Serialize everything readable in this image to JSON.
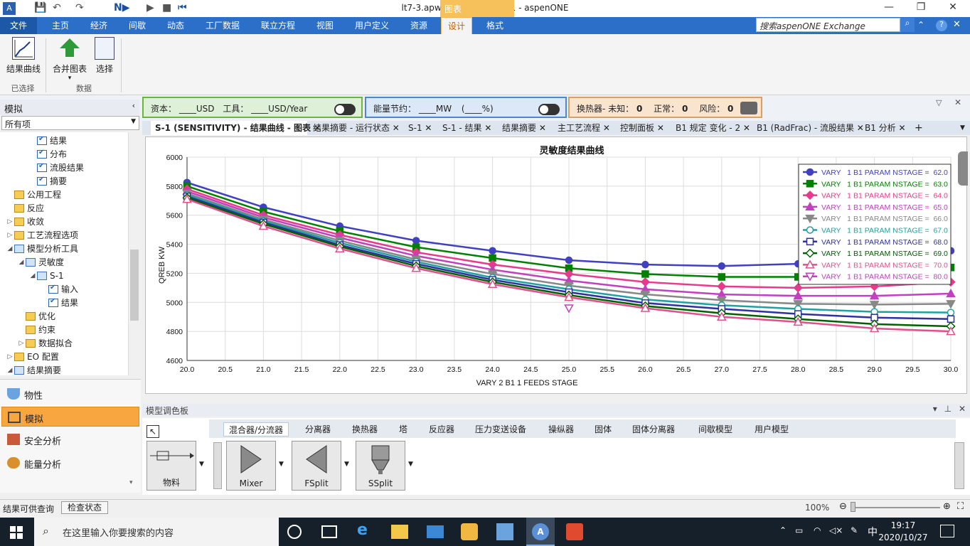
{
  "window": {
    "title": "lt7-3.apw - Aspen Plus V11 - aspenONE",
    "context_tab": "图表"
  },
  "ribbon_tabs": [
    "文件",
    "主页",
    "经济",
    "间歇",
    "动态",
    "工厂数据",
    "联立方程",
    "视图",
    "用户定义",
    "资源",
    "设计",
    "格式"
  ],
  "search": {
    "placeholder": "搜索aspenONE Exchange"
  },
  "ribbon": {
    "result_curve": "结果曲线",
    "merge_chart": "合并图表",
    "select": "选择",
    "group_selected": "已选择",
    "group_data": "数据"
  },
  "info": {
    "capital_label": "资本：",
    "capital_value": "____USD",
    "utility_label": "工具：",
    "utility_value": "____USD/Year",
    "energy_label": "能量节约：",
    "energy_value": "____MW",
    "energy_pct": "(____%)",
    "hx_label": "换热器- 未知：",
    "hx_unknown": "0",
    "hx_normal_label": "正常：",
    "hx_normal": "0",
    "hx_risk_label": "风险：",
    "hx_risk": "0"
  },
  "nav": {
    "title": "模拟",
    "filter": "所有项",
    "tree": [
      {
        "label": "结果",
        "level": 3,
        "icon": "check"
      },
      {
        "label": "分布",
        "level": 3,
        "icon": "check"
      },
      {
        "label": "流股结果",
        "level": 3,
        "icon": "check"
      },
      {
        "label": "摘要",
        "level": 3,
        "icon": "check"
      },
      {
        "label": "公用工程",
        "level": 1,
        "icon": "folder"
      },
      {
        "label": "反应",
        "level": 1,
        "icon": "folder"
      },
      {
        "label": "收敛",
        "level": 1,
        "icon": "folder",
        "tw": "▷"
      },
      {
        "label": "工艺流程选项",
        "level": 1,
        "icon": "folder",
        "tw": "▷"
      },
      {
        "label": "模型分析工具",
        "level": 1,
        "icon": "blue",
        "tw": "◢"
      },
      {
        "label": "灵敏度",
        "level": 2,
        "icon": "blue",
        "tw": "◢"
      },
      {
        "label": "S-1",
        "level": 3,
        "icon": "blue",
        "tw": "◢"
      },
      {
        "label": "输入",
        "level": 4,
        "icon": "check"
      },
      {
        "label": "结果",
        "level": 4,
        "icon": "check"
      },
      {
        "label": "优化",
        "level": 2,
        "icon": "folder"
      },
      {
        "label": "约束",
        "level": 2,
        "icon": "folder"
      },
      {
        "label": "数据拟合",
        "level": 2,
        "icon": "folder",
        "tw": "▷"
      },
      {
        "label": "EO 配置",
        "level": 1,
        "icon": "folder",
        "tw": "▷"
      },
      {
        "label": "结果摘要",
        "level": 1,
        "icon": "blue",
        "tw": "◢"
      }
    ],
    "buttons": [
      "物性",
      "模拟",
      "安全分析",
      "能量分析"
    ]
  },
  "doc_tabs": [
    "S-1 (SENSITIVITY) - 结果曲线 - 图表",
    "结果摘要 - 运行状态",
    "S-1",
    "S-1 - 结果",
    "结果摘要",
    "主工艺流程",
    "控制面板",
    "B1 规定 变化 - 2",
    "B1 (RadFrac) - 流股结果",
    "B1 分析"
  ],
  "palette": {
    "title": "模型调色板",
    "tabs": [
      "混合器/分流器",
      "分离器",
      "换热器",
      "塔",
      "反应器",
      "压力变送设备",
      "操纵器",
      "固体",
      "固体分离器",
      "间歇模型",
      "用户模型"
    ],
    "items": [
      "物料",
      "Mixer",
      "FSplit",
      "SSplit"
    ]
  },
  "status": {
    "left": "结果可供查询",
    "check_btn": "检查状态",
    "zoom": "100%"
  },
  "taskbar": {
    "search": "在这里输入你要搜索的内容",
    "time": "19:17",
    "date": "2020/10/27",
    "ime": "中"
  },
  "chart_data": {
    "type": "line",
    "title": "灵敏度结果曲线",
    "xlabel": "VARY   2 B1 1 FEEDS STAGE",
    "ylabel": "QREB KW",
    "xlim": [
      20,
      30
    ],
    "ylim": [
      4600,
      6000
    ],
    "xticks": [
      "20.0",
      "20.5",
      "21.0",
      "21.5",
      "22.0",
      "22.5",
      "23.0",
      "23.5",
      "24.0",
      "24.5",
      "25.0",
      "25.5",
      "26.0",
      "26.5",
      "27.0",
      "27.5",
      "28.0",
      "28.5",
      "29.0",
      "29.5",
      "30.0"
    ],
    "yticks": [
      "4600",
      "4800",
      "5000",
      "5200",
      "5400",
      "5600",
      "5800",
      "6000"
    ],
    "legend_position": "top-right",
    "grid": true,
    "x": [
      20,
      21,
      22,
      23,
      24,
      25,
      26,
      27,
      28,
      29,
      30
    ],
    "series": [
      {
        "name": "VARY   1 B1 PARAM NSTAGE =  62.0",
        "color": "#4040c0",
        "marker": "circle",
        "values": [
          5825,
          5655,
          5525,
          5425,
          5355,
          5290,
          5260,
          5250,
          5265,
          5290,
          5355
        ]
      },
      {
        "name": "VARY   1 B1 PARAM NSTAGE =  63.0",
        "color": "#008000",
        "marker": "square",
        "values": [
          5800,
          5625,
          5490,
          5380,
          5305,
          5235,
          5195,
          5175,
          5175,
          5190,
          5240
        ]
      },
      {
        "name": "VARY   1 B1 PARAM NSTAGE =  64.0",
        "color": "#e83a8c",
        "marker": "diamond",
        "values": [
          5780,
          5600,
          5465,
          5345,
          5260,
          5195,
          5140,
          5110,
          5100,
          5110,
          5140
        ]
      },
      {
        "name": "VARY   1 B1 PARAM NSTAGE =  65.0",
        "color": "#c040c0",
        "marker": "triangle",
        "values": [
          5765,
          5585,
          5445,
          5320,
          5225,
          5150,
          5090,
          5055,
          5045,
          5045,
          5060
        ]
      },
      {
        "name": "VARY   1 B1 PARAM NSTAGE =  66.0",
        "color": "#888888",
        "marker": "tridown",
        "values": [
          5750,
          5570,
          5425,
          5295,
          5195,
          5115,
          5055,
          5015,
          4990,
          4985,
          4990
        ]
      },
      {
        "name": "VARY   1 B1 PARAM NSTAGE =  67.0",
        "color": "#20a0a0",
        "marker": "ocircle",
        "values": [
          5740,
          5560,
          5410,
          5280,
          5170,
          5090,
          5020,
          4980,
          4955,
          4935,
          4930
        ]
      },
      {
        "name": "VARY   1 B1 PARAM NSTAGE =  68.0",
        "color": "#3030a0",
        "marker": "osquare",
        "values": [
          5730,
          5550,
          5395,
          5265,
          5155,
          5070,
          4995,
          4955,
          4920,
          4895,
          4885
        ]
      },
      {
        "name": "VARY   1 B1 PARAM NSTAGE =  69.0",
        "color": "#006000",
        "marker": "odiamond",
        "values": [
          5720,
          5540,
          5385,
          5250,
          5140,
          5050,
          4975,
          4925,
          4885,
          4850,
          4835
        ]
      },
      {
        "name": "VARY   1 B1 PARAM NSTAGE =  70.0",
        "color": "#e0508c",
        "marker": "otriangle",
        "values": [
          5710,
          5525,
          5370,
          5235,
          5125,
          5035,
          4960,
          4900,
          4865,
          4820,
          4800
        ]
      },
      {
        "name": "VARY   1 B1 PARAM NSTAGE =  80.0",
        "color": "#c040c0",
        "marker": "otridown",
        "values": [
          null,
          null,
          null,
          null,
          null,
          4960,
          null,
          null,
          null,
          null,
          null
        ]
      }
    ]
  }
}
